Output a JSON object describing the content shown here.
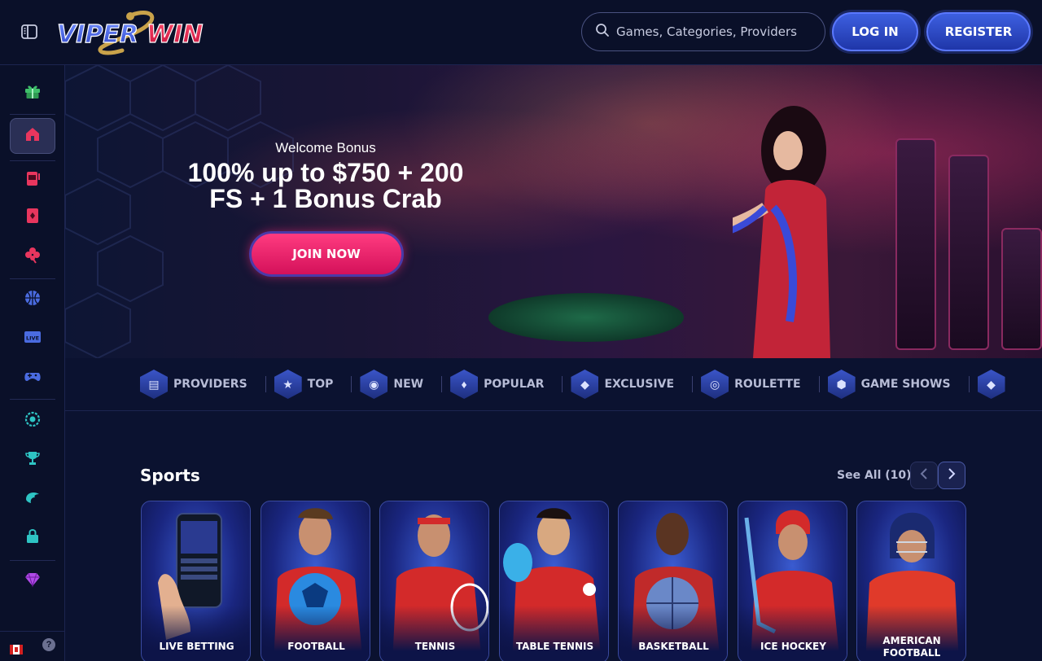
{
  "header": {
    "logo_text_1": "VIPER",
    "logo_text_2": "WIN",
    "search_placeholder": "Games, Categories, Providers",
    "login_label": "LOG IN",
    "register_label": "REGISTER"
  },
  "sidebar": {
    "items": [
      {
        "icon": "gift-icon",
        "color": "#3fbf6a"
      },
      {
        "icon": "home-icon",
        "color": "#e8365e",
        "active": true
      },
      {
        "icon": "slot-machine-icon",
        "color": "#e8365e"
      },
      {
        "icon": "card-icon",
        "color": "#e8365e"
      },
      {
        "icon": "clover-icon",
        "color": "#e8365e"
      },
      {
        "icon": "basketball-icon",
        "color": "#4a6be0"
      },
      {
        "icon": "live-icon",
        "color": "#4a6be0",
        "label": "LIVE"
      },
      {
        "icon": "gamepad-icon",
        "color": "#4a6be0"
      },
      {
        "icon": "badge-icon",
        "color": "#2ec4c4"
      },
      {
        "icon": "trophy-icon",
        "color": "#2ec4c4"
      },
      {
        "icon": "crab-icon",
        "color": "#2ec4c4"
      },
      {
        "icon": "shop-icon",
        "color": "#2ec4c4"
      },
      {
        "icon": "diamond-icon",
        "color": "#b04ae8"
      }
    ]
  },
  "hero": {
    "subtitle": "Welcome Bonus",
    "title_line1": "100% up to $750 + 200",
    "title_line2": "FS + 1 Bonus Crab",
    "cta_label": "JOIN NOW"
  },
  "categories": [
    {
      "label": "PROVIDERS",
      "icon": "book-icon"
    },
    {
      "label": "TOP",
      "icon": "star-icon"
    },
    {
      "label": "NEW",
      "icon": "new-icon"
    },
    {
      "label": "POPULAR",
      "icon": "flame-icon"
    },
    {
      "label": "EXCLUSIVE",
      "icon": "diamond-icon"
    },
    {
      "label": "ROULETTE",
      "icon": "roulette-icon"
    },
    {
      "label": "GAME SHOWS",
      "icon": "gem-icon"
    }
  ],
  "sports": {
    "title": "Sports",
    "see_all": "See All (10)",
    "cards": [
      {
        "name": "LIVE BETTING"
      },
      {
        "name": "FOOTBALL"
      },
      {
        "name": "TENNIS"
      },
      {
        "name": "TABLE TENNIS"
      },
      {
        "name": "BASKETBALL"
      },
      {
        "name": "ICE HOCKEY"
      },
      {
        "name": "AMERICAN FOOTBALL"
      }
    ]
  },
  "footer": {
    "help_label": "?"
  }
}
